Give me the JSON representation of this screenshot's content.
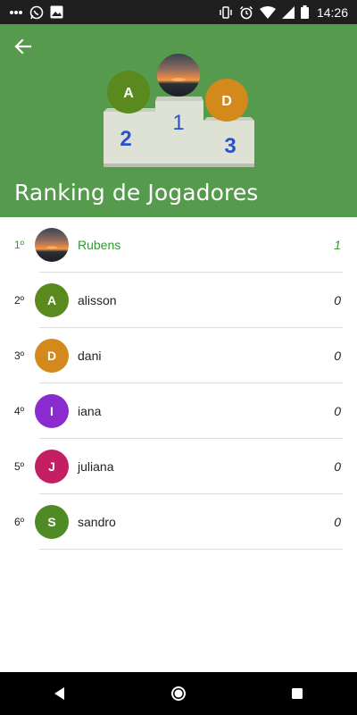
{
  "status_bar": {
    "time": "14:26",
    "icons": [
      "dots-icon",
      "whatsapp-icon",
      "image-icon",
      "vibrate-icon",
      "alarm-icon",
      "wifi-icon",
      "signal-icon",
      "battery-icon"
    ]
  },
  "header": {
    "title": "Ranking de Jogadores",
    "background_color": "#559a4d",
    "podium": {
      "first": {
        "place": "1",
        "avatar_type": "sunset-photo"
      },
      "second": {
        "place": "2",
        "avatar_letter": "A",
        "avatar_color": "#5a8a1e"
      },
      "third": {
        "place": "3",
        "avatar_letter": "D",
        "avatar_color": "#d4891c"
      }
    }
  },
  "ranking": [
    {
      "position": "1º",
      "name": "Rubens",
      "score": "1",
      "avatar_type": "sunset-photo",
      "avatar_letter": "",
      "avatar_color": "#555555"
    },
    {
      "position": "2º",
      "name": "alisson",
      "score": "0",
      "avatar_type": "letter",
      "avatar_letter": "A",
      "avatar_color": "#5a8a1e"
    },
    {
      "position": "3º",
      "name": "dani",
      "score": "0",
      "avatar_type": "letter",
      "avatar_letter": "D",
      "avatar_color": "#d4891c"
    },
    {
      "position": "4º",
      "name": "iana",
      "score": "0",
      "avatar_type": "letter",
      "avatar_letter": "I",
      "avatar_color": "#8a2bd0"
    },
    {
      "position": "5º",
      "name": "juliana",
      "score": "0",
      "avatar_type": "letter",
      "avatar_letter": "J",
      "avatar_color": "#c41f63"
    },
    {
      "position": "6º",
      "name": "sandro",
      "score": "0",
      "avatar_type": "letter",
      "avatar_letter": "S",
      "avatar_color": "#4f8a24"
    }
  ],
  "colors": {
    "leader_text": "#2e9a2e",
    "podium_numbers": "#2c52c9"
  },
  "nav_bar": {
    "buttons": [
      "back-triangle-icon",
      "home-circle-icon",
      "overview-square-icon"
    ]
  }
}
